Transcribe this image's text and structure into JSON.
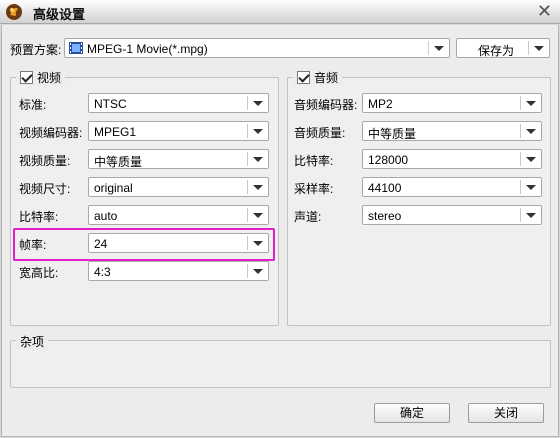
{
  "window": {
    "title": "高级设置",
    "close_symbol": "✕"
  },
  "preset": {
    "label": "预置方案:",
    "value": "MPEG-1 Movie(*.mpg)",
    "save_as": "保存为"
  },
  "video": {
    "title": "视频",
    "enabled": true,
    "rows": [
      {
        "label": "标准:",
        "value": "NTSC"
      },
      {
        "label": "视频编码器:",
        "value": "MPEG1"
      },
      {
        "label": "视频质量:",
        "value": "中等质量"
      },
      {
        "label": "视频尺寸:",
        "value": "original"
      },
      {
        "label": "比特率:",
        "value": "auto"
      },
      {
        "label": "帧率:",
        "value": "24"
      },
      {
        "label": "宽高比:",
        "value": "4:3"
      }
    ]
  },
  "audio": {
    "title": "音频",
    "enabled": true,
    "rows": [
      {
        "label": "音频编码器:",
        "value": "MP2"
      },
      {
        "label": "音频质量:",
        "value": "中等质量"
      },
      {
        "label": "比特率:",
        "value": "128000"
      },
      {
        "label": "采样率:",
        "value": "44100"
      },
      {
        "label": "声道:",
        "value": "stereo"
      }
    ]
  },
  "misc": {
    "title": "杂项"
  },
  "buttons": {
    "ok": "确定",
    "close": "关闭"
  },
  "colors": {
    "highlight": "#e020c8"
  }
}
